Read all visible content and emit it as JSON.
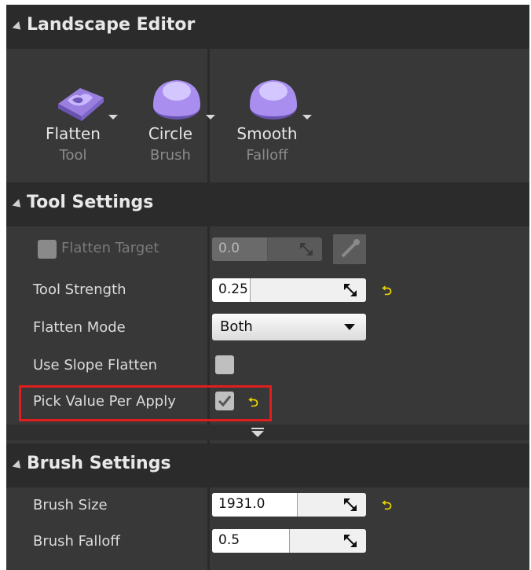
{
  "landscape_editor": {
    "title": "Landscape Editor"
  },
  "tools": [
    {
      "main": "Flatten",
      "sub": "Tool",
      "icon": "flatten-tool-icon"
    },
    {
      "main": "Circle",
      "sub": "Brush",
      "icon": "circle-brush-icon"
    },
    {
      "main": "Smooth",
      "sub": "Falloff",
      "icon": "smooth-falloff-icon"
    }
  ],
  "tool_settings": {
    "title": "Tool Settings",
    "flatten_target": {
      "label": "Flatten Target",
      "value": "0.0"
    },
    "tool_strength": {
      "label": "Tool Strength",
      "value": "0.25"
    },
    "flatten_mode": {
      "label": "Flatten Mode",
      "value": "Both"
    },
    "use_slope_flatten": {
      "label": "Use Slope Flatten",
      "checked": false
    },
    "pick_value_per_apply": {
      "label": "Pick Value Per Apply",
      "checked": true
    }
  },
  "brush_settings": {
    "title": "Brush Settings",
    "brush_size": {
      "label": "Brush Size",
      "value": "1931.0"
    },
    "brush_falloff": {
      "label": "Brush Falloff",
      "value": "0.5"
    }
  },
  "colors": {
    "panel": "#383838",
    "header": "#2b2b2b",
    "reset_arrow": "#e8d200",
    "highlight": "#e01e1e",
    "purple_icon": "#a98ef0"
  }
}
